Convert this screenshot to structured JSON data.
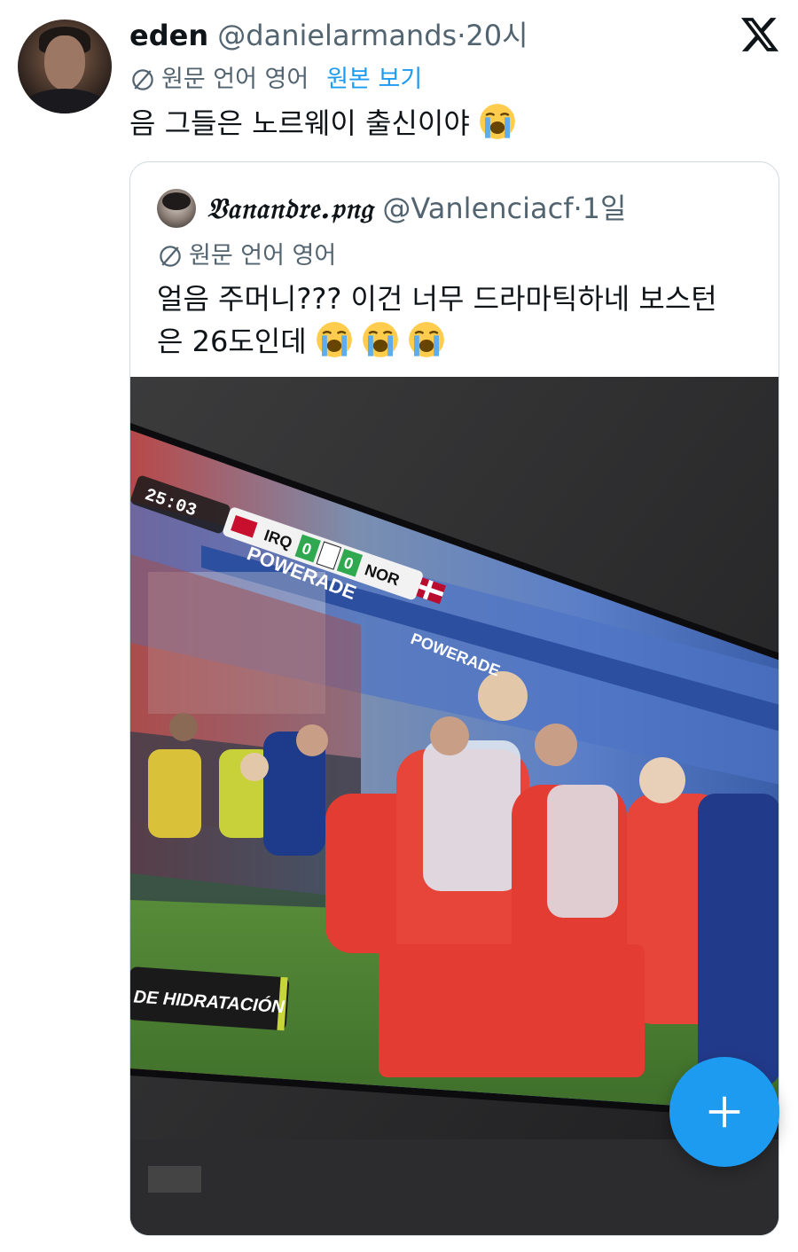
{
  "tweet": {
    "display_name": "eden",
    "handle": "@danielarmands",
    "separator": "·",
    "time": "20시",
    "translate_label": "원문 언어 영어",
    "translate_link": "원본 보기",
    "text": "음 그들은 노르웨이 출신이야"
  },
  "quote": {
    "display_name": "𝔙𝔞𝔫𝔞𝔫𝔡𝔯𝔢.𝔭𝔫𝔤",
    "handle": "@Vanlenciacf",
    "separator": "·",
    "time": "1일",
    "translate_label": "원문 언어 영어",
    "text_line1": "얼음 주머니??? 이건 너무 드라마틱하네 보스턴",
    "text_line2": "은 26도인데"
  },
  "media": {
    "scoreboard_time": "25:03",
    "team_home": "IRQ",
    "score_home": "0",
    "score_away": "0",
    "team_away": "NOR",
    "banner": "DE HIDRATACIÓN",
    "ad_text": "POWERADE"
  },
  "icons": {
    "x_logo": "x-logo-icon",
    "translate": "translate-icon",
    "fab": "plus-icon",
    "emoji": "loudly-crying-face-emoji"
  },
  "colors": {
    "accent": "#1d9bf0",
    "secondary_text": "#536471",
    "border": "#cfd9de"
  }
}
